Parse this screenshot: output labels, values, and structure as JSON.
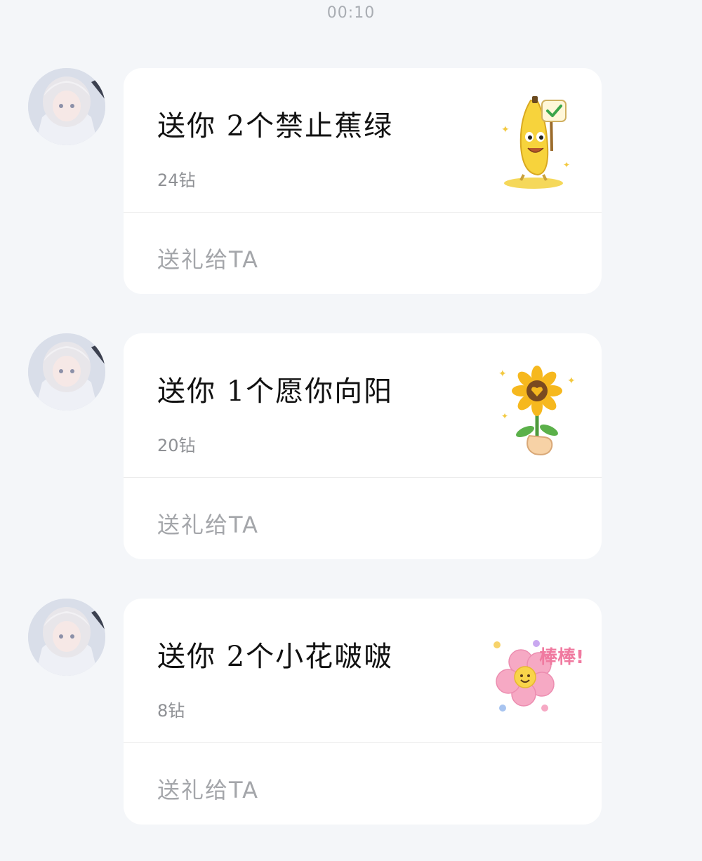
{
  "timestamp": "00:10",
  "messages": [
    {
      "title": "送你 2个禁止蕉绿",
      "price": "24钻",
      "action": "送礼给TA",
      "gift_icon": "banana-thumbs-up-icon"
    },
    {
      "title": "送你 1个愿你向阳",
      "price": "20钻",
      "action": "送礼给TA",
      "gift_icon": "sunflower-in-hand-icon"
    },
    {
      "title": "送你 2个小花啵啵",
      "price": "8钻",
      "action": "送礼给TA",
      "gift_icon": "pink-flower-smile-icon",
      "sticker_text": "棒棒!"
    }
  ],
  "colors": {
    "background": "#f4f6f9",
    "card": "#ffffff",
    "title": "#111111",
    "price": "#8e9094",
    "action": "#a4a6aa"
  }
}
